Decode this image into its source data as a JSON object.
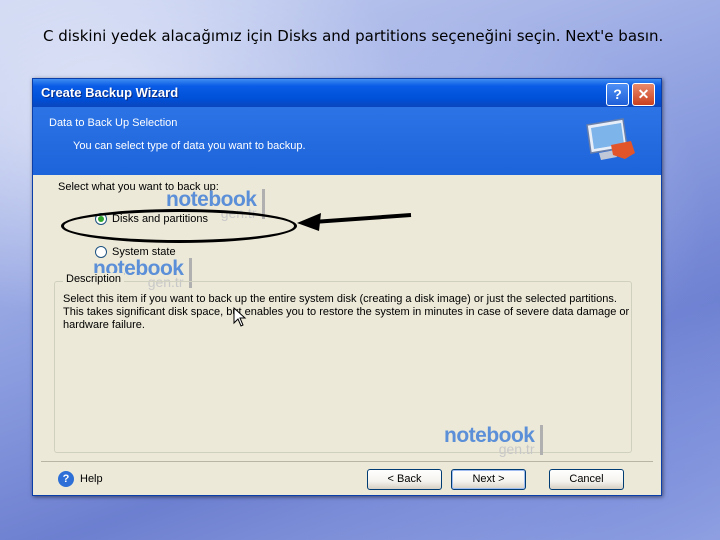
{
  "caption": "C diskini yedek alacağımız için Disks and partitions seçeneğini seçin. Next'e basın.",
  "window": {
    "title": "Create Backup Wizard",
    "help_glyph": "?",
    "close_glyph": "✕"
  },
  "header": {
    "title": "Data to Back Up Selection",
    "subtitle": "You can select type of data you want to backup."
  },
  "selection": {
    "label": "Select what you want to back up:",
    "options": [
      {
        "label": "Disks and partitions",
        "selected": true
      },
      {
        "label": "System state",
        "selected": false
      }
    ]
  },
  "description": {
    "legend": "Description",
    "text": "Select this item if you want to back up the entire system disk (creating a disk image) or just the selected partitions. This takes significant disk space, but enables you to restore the system in minutes in case of severe data damage or hardware failure."
  },
  "watermark": {
    "brand": "notebook",
    "domain": "gen.tr"
  },
  "footer": {
    "help_label": "Help",
    "help_icon_glyph": "?",
    "back_label": "< Back",
    "next_label": "Next >",
    "cancel_label": "Cancel"
  },
  "colors": {
    "titlebar": "#0050d8",
    "header_band": "#1d63da",
    "dialog_bg": "#ece9d8",
    "watermark_blue": "#5b8fd8"
  },
  "icons": {
    "header_graphic": "monitor-icon",
    "help": "help-icon",
    "annotation": "arrow-icon"
  }
}
